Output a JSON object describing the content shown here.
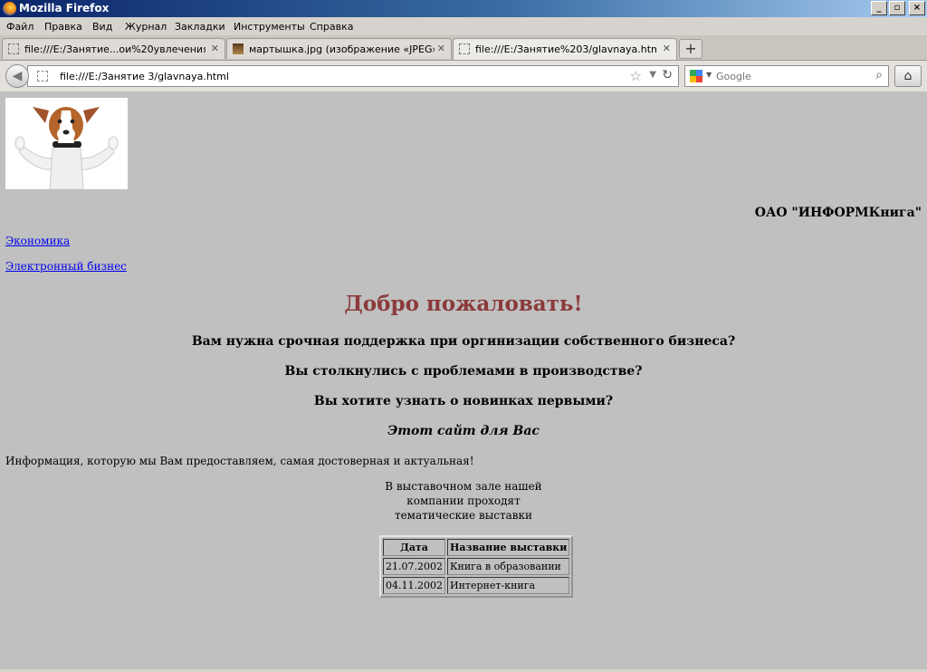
{
  "window": {
    "title": "Mozilla Firefox"
  },
  "menu": [
    "Файл",
    "Правка",
    "Вид",
    "Журнал",
    "Закладки",
    "Инструменты",
    "Справка"
  ],
  "tabs": [
    {
      "label": "file:///E:/Занятие...ои%20увлечения.htm"
    },
    {
      "label": "мартышка.jpg (изображение «JPEG», 6..."
    },
    {
      "label": "file:///E:/Занятие%203/glavnaya.html"
    }
  ],
  "newtab_label": "+",
  "address": {
    "url": "file:///E:/Занятие 3/glavnaya.html"
  },
  "search": {
    "placeholder": "Google"
  },
  "page": {
    "company": "ОАО \"ИНФОРМКнига\"",
    "links": [
      "Экономика",
      "Электронный бизнес"
    ],
    "welcome": "Добро пожаловать!",
    "questions": [
      "Вам нужна срочная поддержка при оргинизации собственного бизнеса?",
      "Вы столкнулись с проблемами в производстве?",
      "Вы хотите узнать о новинках первыми?"
    ],
    "slogan": "Этот сайт для Вас",
    "info": "Информация, которую мы Вам предоставляем, самая достоверная и актуальная!",
    "exhibition_lines": [
      "В выставочном зале нашей",
      "компании проходят",
      "тематические выставки"
    ],
    "table": {
      "headers": [
        "Дата",
        "Название выставки"
      ],
      "rows": [
        [
          "21.07.2002",
          "Книга в образовании"
        ],
        [
          "04.11.2002",
          "Интернет-книга"
        ]
      ]
    }
  },
  "colors": {
    "welcome": "#8b3a3a",
    "link": "#0000ee",
    "page_bg": "#c0c0c0"
  }
}
